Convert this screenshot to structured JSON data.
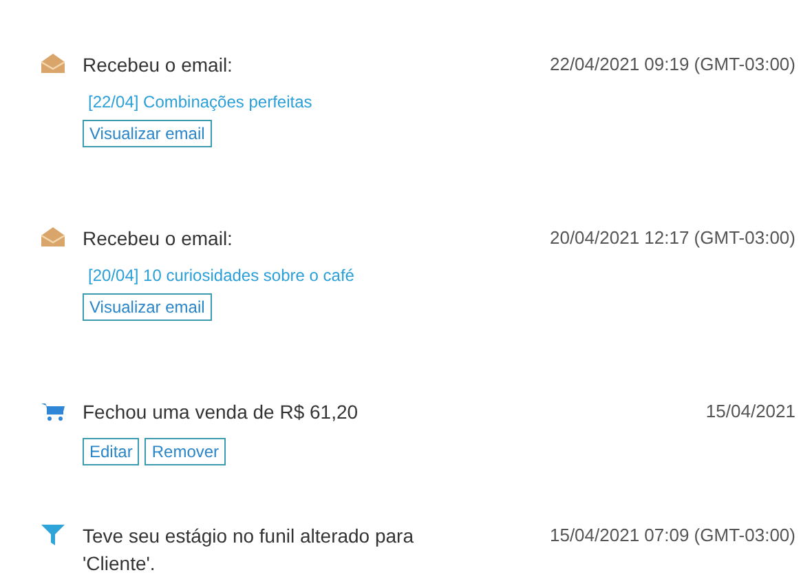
{
  "activities": [
    {
      "kind": "email",
      "title": "Recebeu o email:",
      "date": "22/04/2021 09:19 (GMT-03:00)",
      "link": "[22/04] Combinações perfeitas",
      "buttons": [
        "Visualizar email"
      ]
    },
    {
      "kind": "email",
      "title": "Recebeu o email:",
      "date": "20/04/2021 12:17 (GMT-03:00)",
      "link": "[20/04] 10 curiosidades sobre o café",
      "buttons": [
        "Visualizar email"
      ]
    },
    {
      "kind": "sale",
      "title": "Fechou uma venda de R$ 61,20",
      "date": "15/04/2021",
      "buttons": [
        "Editar",
        "Remover"
      ]
    },
    {
      "kind": "funnel",
      "title": "Teve seu estágio no funil alterado para 'Cliente'.",
      "date": "15/04/2021 07:09 (GMT-03:00)"
    }
  ]
}
